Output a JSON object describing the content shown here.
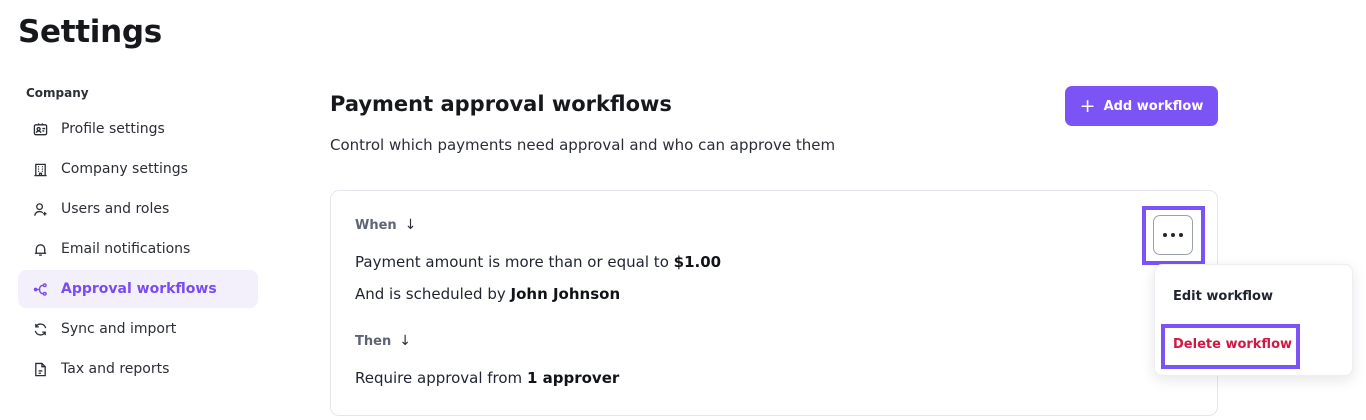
{
  "page": {
    "title": "Settings"
  },
  "sidebar": {
    "section_label": "Company",
    "items": [
      {
        "label": "Profile settings",
        "icon": "id-card-icon",
        "active": false
      },
      {
        "label": "Company settings",
        "icon": "building-icon",
        "active": false
      },
      {
        "label": "Users and roles",
        "icon": "user-icon",
        "active": false
      },
      {
        "label": "Email notifications",
        "icon": "bell-icon",
        "active": false
      },
      {
        "label": "Approval workflows",
        "icon": "workflow-icon",
        "active": true
      },
      {
        "label": "Sync and import",
        "icon": "sync-icon",
        "active": false
      },
      {
        "label": "Tax and reports",
        "icon": "document-icon",
        "active": false
      }
    ]
  },
  "main": {
    "title": "Payment approval workflows",
    "subtitle": "Control which payments need approval and who can approve them",
    "add_button_label": "Add workflow"
  },
  "workflow": {
    "when_label": "When",
    "condition_1_prefix": "Payment amount is more than or equal to",
    "condition_1_value": "$1.00",
    "condition_2_prefix": "And is scheduled by",
    "condition_2_value": "John Johnson",
    "then_label": "Then",
    "action_prefix": "Require approval from",
    "action_value": "1 approver"
  },
  "menu": {
    "edit_label": "Edit workflow",
    "delete_label": "Delete workflow"
  },
  "colors": {
    "accent": "#7c53f5",
    "active_bg": "#f3f0fc",
    "danger": "#d01842",
    "muted_text": "#5f6474"
  }
}
